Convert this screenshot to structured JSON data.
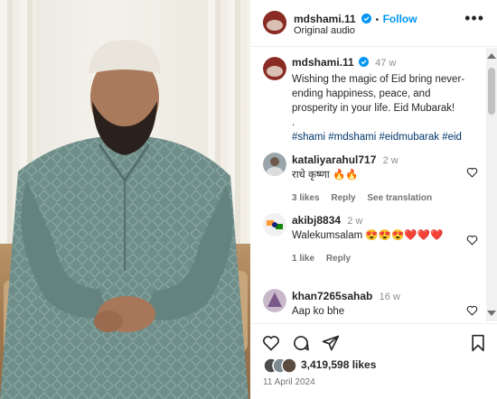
{
  "header": {
    "username": "mdshami.11",
    "separator": "•",
    "follow_label": "Follow",
    "audio_label": "Original audio",
    "more_label": "•••"
  },
  "caption": {
    "username": "mdshami.11",
    "time": "47 w",
    "text": "Wishing the magic of Eid bring never-ending happiness, peace, and prosperity in your life. Eid Mubarak!",
    "dot": ".",
    "hashtags": "#shami #mdshami #eidmubarak #eid"
  },
  "comments": [
    {
      "username": "kataliyarahul717",
      "time": "2 w",
      "text": "राधे कृष्णा 🔥🔥",
      "likes": "3 likes",
      "reply": "Reply",
      "see_translation": "See translation"
    },
    {
      "username": "akibj8834",
      "time": "2 w",
      "text": "Walekumsalam 😍😍😍❤️❤️❤️",
      "likes": "1 like",
      "reply": "Reply"
    },
    {
      "username": "khan7265sahab",
      "time": "16 w",
      "text": "Aap ko bhe"
    }
  ],
  "post": {
    "likes": "3,419,598 likes",
    "date": "11 April 2024"
  },
  "icons": {
    "verified": "verified-badge-icon",
    "heart": "heart-icon",
    "comment": "comment-icon",
    "share": "share-icon",
    "save": "bookmark-icon"
  },
  "colors": {
    "accent": "#0095f6",
    "verified": "#0095f6",
    "hashtag": "#00376b"
  }
}
